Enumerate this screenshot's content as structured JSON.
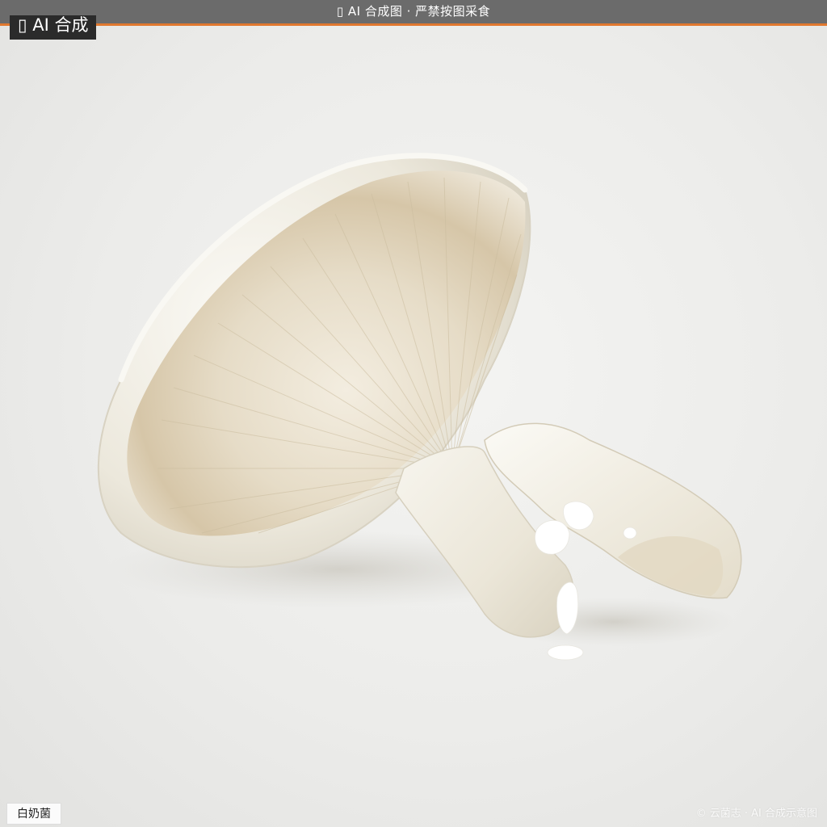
{
  "banner": {
    "icon": "ai-icon",
    "text": "AI 合成图 · 严禁按图采食"
  },
  "badge": {
    "icon": "ai-icon",
    "text": "AI 合成"
  },
  "caption": {
    "species": "白奶菌"
  },
  "watermark": {
    "text": "© 云菌志 · AI 合成示意图"
  },
  "colors": {
    "banner_bg": "#6b6b6b",
    "banner_accent": "#e0782f",
    "badge_bg": "#2b2b2b",
    "mushroom": "#f2efe6",
    "gills": "#e6dccb",
    "latex": "#ffffff"
  }
}
